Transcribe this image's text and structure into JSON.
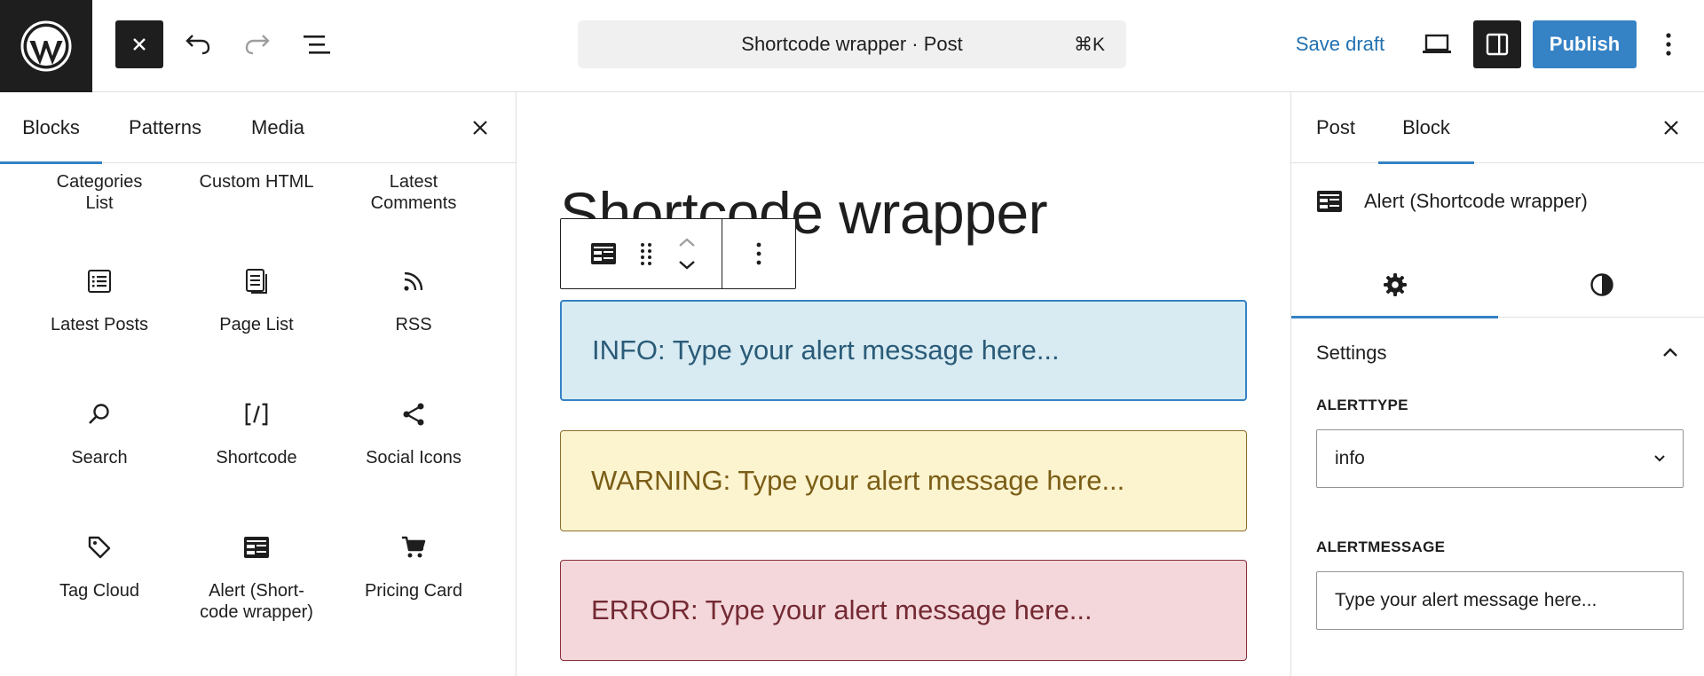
{
  "topbar": {
    "command_title": "Shortcode wrapper · Post",
    "command_shortcut": "⌘K",
    "save_draft": "Save draft",
    "publish": "Publish"
  },
  "inserter": {
    "tabs": [
      "Blocks",
      "Patterns",
      "Media"
    ],
    "blocks": [
      {
        "label": "Categories List",
        "icon": "categories-icon"
      },
      {
        "label": "Custom HTML",
        "icon": "html-icon"
      },
      {
        "label": "Latest Comments",
        "icon": "comments-icon"
      },
      {
        "label": "Latest Posts",
        "icon": "list-icon"
      },
      {
        "label": "Page List",
        "icon": "page-list-icon"
      },
      {
        "label": "RSS",
        "icon": "rss-icon"
      },
      {
        "label": "Search",
        "icon": "search-icon"
      },
      {
        "label": "Shortcode",
        "icon": "shortcode-icon"
      },
      {
        "label": "Social Icons",
        "icon": "share-icon"
      },
      {
        "label": "Tag Cloud",
        "icon": "tag-icon"
      },
      {
        "label": "Alert (Short-code wrapper)",
        "icon": "alert-block-icon"
      },
      {
        "label": "Pricing Card",
        "icon": "cart-icon"
      }
    ]
  },
  "canvas": {
    "post_title": "Shortcode wrapper",
    "alerts": [
      {
        "type": "info",
        "text": "INFO: Type your alert message here..."
      },
      {
        "type": "warning",
        "text": "WARNING: Type your alert message here..."
      },
      {
        "type": "error",
        "text": "ERROR: Type your alert message here..."
      }
    ]
  },
  "sidebar": {
    "tabs": [
      "Post",
      "Block"
    ],
    "block_name": "Alert (Shortcode wrapper)",
    "settings_title": "Settings",
    "alerttype_label": "ALERTTYPE",
    "alerttype_value": "info",
    "alertmessage_label": "ALERTMESSAGE",
    "alertmessage_value": "Type your alert message here..."
  },
  "colors": {
    "accent": "#3582c4",
    "link": "#2271b1",
    "info_bg": "#d8ebf2",
    "warning_bg": "#fcf3cf",
    "error_bg": "#f3d7db"
  }
}
